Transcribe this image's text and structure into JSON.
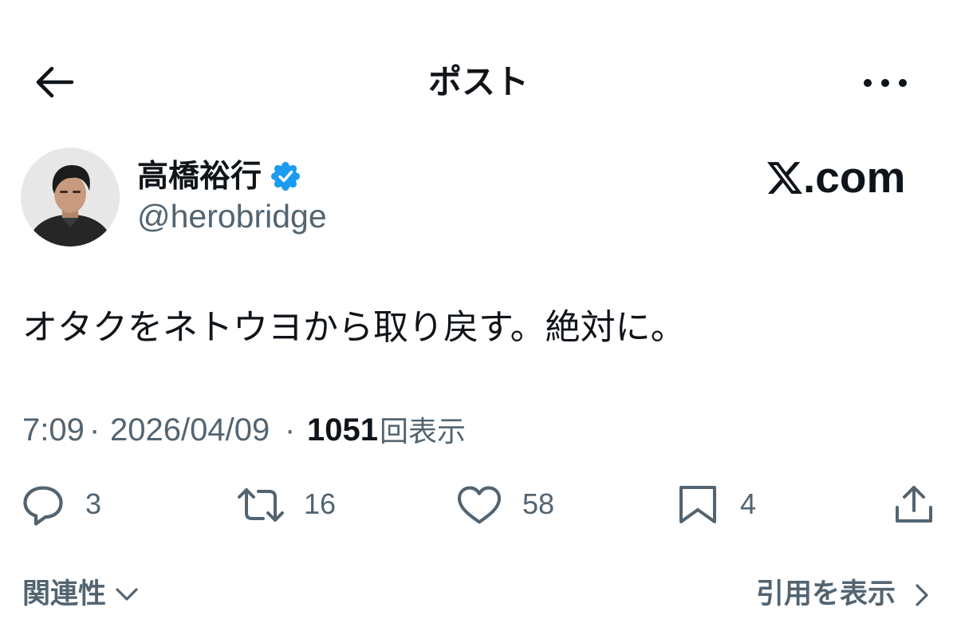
{
  "header": {
    "title": "ポスト"
  },
  "author": {
    "name": "高橋裕行",
    "handle": "@herobridge",
    "verified": true
  },
  "watermark": {
    "logo": "X",
    "suffix": ".com"
  },
  "post": {
    "text": "オタクをネトウヨから取り戻す。絶対に。"
  },
  "meta": {
    "time": "7:09",
    "separator": "·",
    "date": "2026/04/09",
    "views_count": "1051",
    "views_label": "回表示"
  },
  "actions": {
    "replies": "3",
    "reposts": "16",
    "likes": "58",
    "bookmarks": "4"
  },
  "footer": {
    "sort_label": "関連性",
    "quotes_label": "引用を表示"
  },
  "icons": {
    "back": "arrow-left-icon",
    "more": "more-horizontal-icon",
    "verified": "verified-badge-icon",
    "reply": "reply-icon",
    "repost": "repost-icon",
    "like": "heart-icon",
    "bookmark": "bookmark-icon",
    "share": "share-icon",
    "sort": "chevron-down-icon",
    "quotes": "chevron-right-icon",
    "watermark": "x-logo-icon"
  },
  "colors": {
    "text": "#0f1419",
    "secondary": "#536471",
    "verified": "#1d9bf0",
    "background": "#ffffff"
  }
}
